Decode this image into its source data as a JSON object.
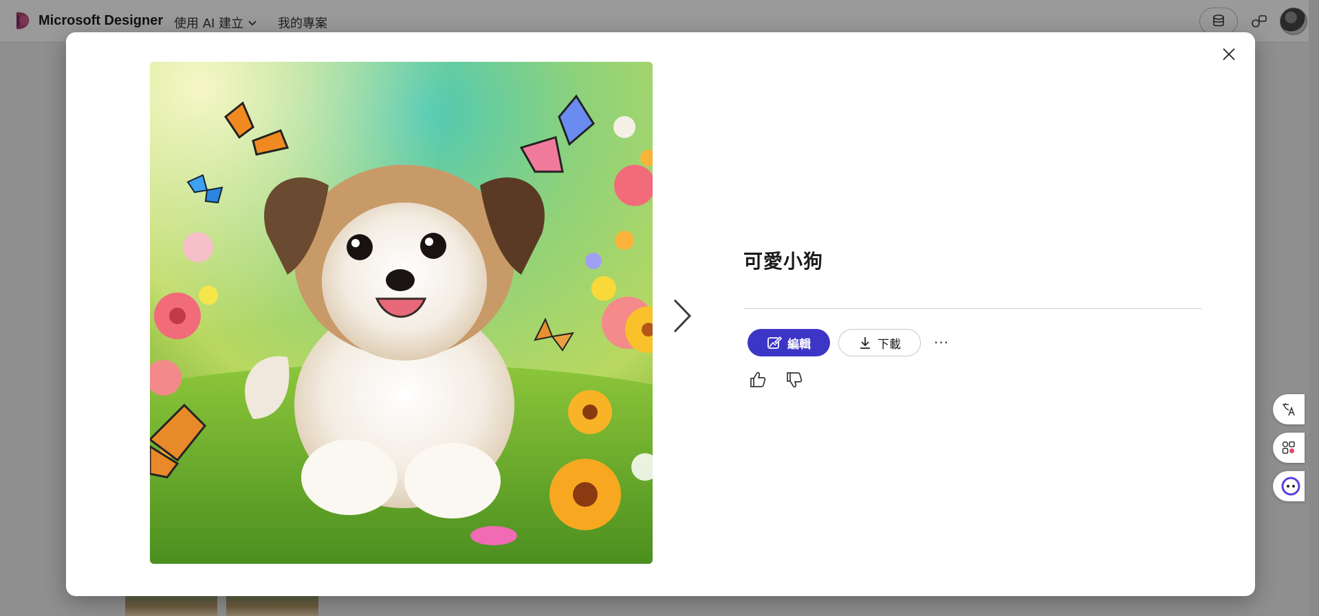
{
  "app": {
    "brand_name": "Microsoft Designer",
    "nav_create_label": "使用 AI 建立",
    "nav_projects_label": "我的專案"
  },
  "modal": {
    "title": "可愛小狗",
    "edit_label": "編輯",
    "download_label": "下載",
    "more_label": "···"
  },
  "colors": {
    "accent": "#3c35c6",
    "overlay": "#8f8f8f"
  },
  "icons": {
    "close": "close-icon",
    "next": "chevron-right-icon",
    "edit": "image-edit-icon",
    "download": "download-icon",
    "like": "thumbs-up-icon",
    "dislike": "thumbs-down-icon",
    "credits": "coins-icon",
    "share": "share-icon",
    "translate": "translate-icon",
    "apps": "apps-icon",
    "assistant": "assistant-icon"
  }
}
